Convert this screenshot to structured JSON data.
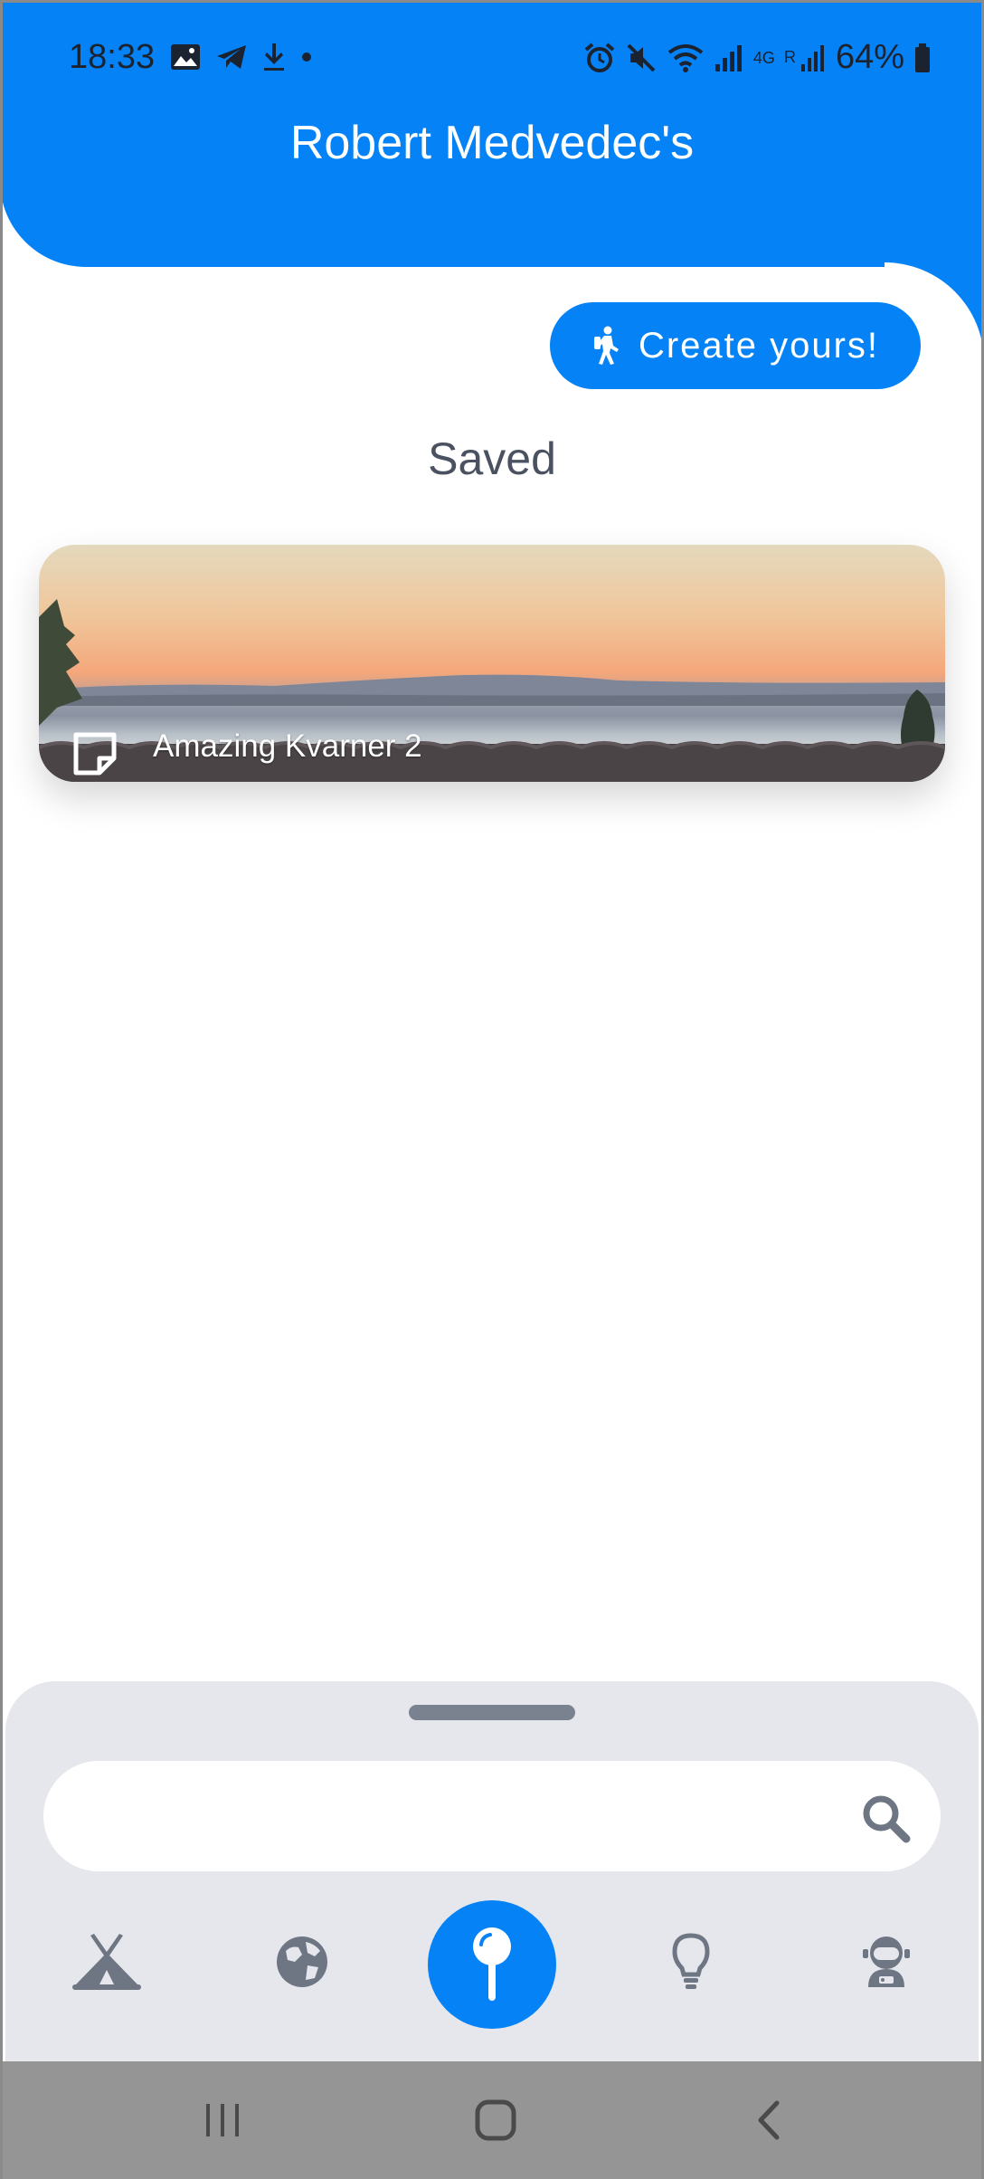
{
  "status_bar": {
    "time": "18:33",
    "battery": "64%",
    "network": "4G",
    "roaming": "R"
  },
  "header": {
    "title": "Robert Medvedec's"
  },
  "create_button": {
    "label": "Create yours!",
    "icon": "hiking-icon"
  },
  "section": {
    "title": "Saved"
  },
  "saved_items": [
    {
      "title": "Amazing Kvarner 2",
      "icon": "note-icon"
    }
  ],
  "search": {
    "value": "",
    "placeholder": ""
  },
  "bottom_nav": {
    "items": [
      {
        "icon": "tent-icon",
        "active": false
      },
      {
        "icon": "globe-icon",
        "active": false
      },
      {
        "icon": "pin-icon",
        "active": true
      },
      {
        "icon": "lightbulb-icon",
        "active": false
      },
      {
        "icon": "astronaut-icon",
        "active": false
      }
    ]
  },
  "colors": {
    "accent": "#0583f6",
    "sheet_bg": "#e5e7ec",
    "nav_icon": "#6f7683",
    "title_text": "#4a5160"
  }
}
